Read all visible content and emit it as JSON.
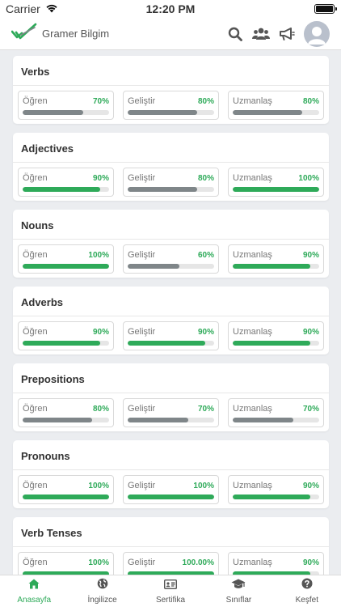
{
  "status": {
    "carrier": "Carrier",
    "time": "12:20 PM"
  },
  "header": {
    "app_name": "Gramer Bilgim"
  },
  "colors": {
    "accent": "#2eaa59",
    "bar_gray": "#7f8689"
  },
  "categories": [
    {
      "title": "Verbs",
      "stats": [
        {
          "label": "Öğren",
          "value": "70%",
          "fraction": 0.7,
          "complete": false
        },
        {
          "label": "Geliştir",
          "value": "80%",
          "fraction": 0.8,
          "complete": false
        },
        {
          "label": "Uzmanlaş",
          "value": "80%",
          "fraction": 0.8,
          "complete": false
        }
      ]
    },
    {
      "title": "Adjectives",
      "stats": [
        {
          "label": "Öğren",
          "value": "90%",
          "fraction": 0.9,
          "complete": true
        },
        {
          "label": "Geliştir",
          "value": "80%",
          "fraction": 0.8,
          "complete": false
        },
        {
          "label": "Uzmanlaş",
          "value": "100%",
          "fraction": 1.0,
          "complete": true
        }
      ]
    },
    {
      "title": "Nouns",
      "stats": [
        {
          "label": "Öğren",
          "value": "100%",
          "fraction": 1.0,
          "complete": true
        },
        {
          "label": "Geliştir",
          "value": "60%",
          "fraction": 0.6,
          "complete": false
        },
        {
          "label": "Uzmanlaş",
          "value": "90%",
          "fraction": 0.9,
          "complete": true
        }
      ]
    },
    {
      "title": "Adverbs",
      "stats": [
        {
          "label": "Öğren",
          "value": "90%",
          "fraction": 0.9,
          "complete": true
        },
        {
          "label": "Geliştir",
          "value": "90%",
          "fraction": 0.9,
          "complete": true
        },
        {
          "label": "Uzmanlaş",
          "value": "90%",
          "fraction": 0.9,
          "complete": true
        }
      ]
    },
    {
      "title": "Prepositions",
      "stats": [
        {
          "label": "Öğren",
          "value": "80%",
          "fraction": 0.8,
          "complete": false
        },
        {
          "label": "Geliştir",
          "value": "70%",
          "fraction": 0.7,
          "complete": false
        },
        {
          "label": "Uzmanlaş",
          "value": "70%",
          "fraction": 0.7,
          "complete": false
        }
      ]
    },
    {
      "title": "Pronouns",
      "stats": [
        {
          "label": "Öğren",
          "value": "100%",
          "fraction": 1.0,
          "complete": true
        },
        {
          "label": "Geliştir",
          "value": "100%",
          "fraction": 1.0,
          "complete": true
        },
        {
          "label": "Uzmanlaş",
          "value": "90%",
          "fraction": 0.9,
          "complete": true
        }
      ]
    },
    {
      "title": "Verb Tenses",
      "stats": [
        {
          "label": "Öğren",
          "value": "100%",
          "fraction": 1.0,
          "complete": true
        },
        {
          "label": "Geliştir",
          "value": "100.00%",
          "fraction": 1.0,
          "complete": true
        },
        {
          "label": "Uzmanlaş",
          "value": "90%",
          "fraction": 0.9,
          "complete": true
        }
      ]
    }
  ],
  "tabs": [
    {
      "label": "Anasayfa",
      "icon": "home-icon",
      "active": true
    },
    {
      "label": "İngilizce",
      "icon": "globe-icon",
      "active": false
    },
    {
      "label": "Sertifika",
      "icon": "certificate-icon",
      "active": false
    },
    {
      "label": "Sınıflar",
      "icon": "graduation-cap-icon",
      "active": false
    },
    {
      "label": "Keşfet",
      "icon": "question-icon",
      "active": false
    }
  ]
}
